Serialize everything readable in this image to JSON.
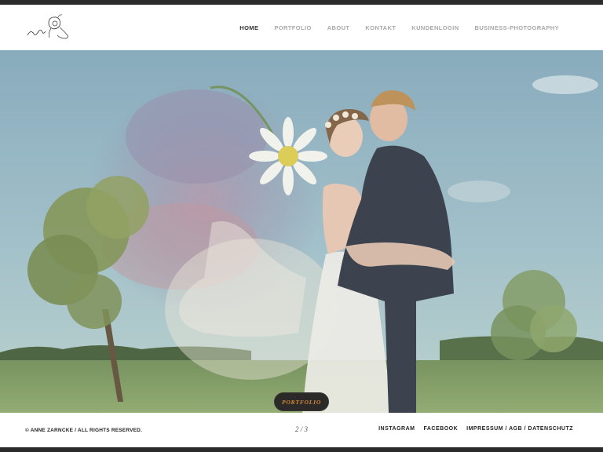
{
  "nav": {
    "items": [
      {
        "label": "HOME",
        "active": true
      },
      {
        "label": "PORTFOLIO",
        "active": false
      },
      {
        "label": "ABOUT",
        "active": false
      },
      {
        "label": "KONTAKT",
        "active": false
      },
      {
        "label": "KUNDENLOGIN",
        "active": false
      },
      {
        "label": "BUSINESS-PHOTOGRAPHY",
        "active": false
      }
    ]
  },
  "logo": {
    "signature_text": "Anne"
  },
  "hero": {
    "button_label": "PORTFOLIO",
    "image": "wedding-couple-with-daisy-double-exposure"
  },
  "footer": {
    "copyright": "© ANNE ZARNCKE / ALL RIGHTS RESERVED.",
    "pager": "2 / 3",
    "links": [
      "INSTAGRAM",
      "FACEBOOK",
      "IMPRESSUM / AGB / DATENSCHUTZ"
    ]
  },
  "colors": {
    "nav_active": "#333333",
    "nav_inactive": "#a8a8a8",
    "button_bg": "#2c2a28",
    "button_text": "#d4883a"
  }
}
